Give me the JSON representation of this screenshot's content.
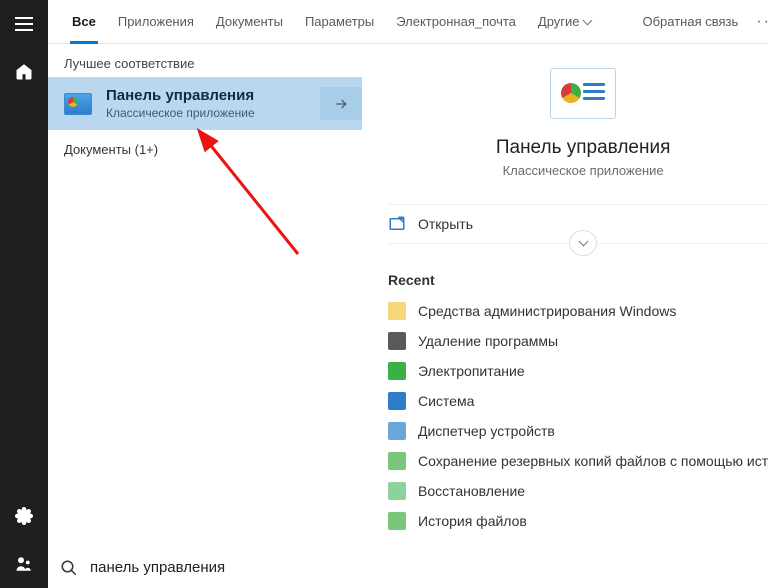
{
  "tabs": {
    "all": "Все",
    "apps": "Приложения",
    "docs": "Документы",
    "settings": "Параметры",
    "email": "Электронная_почта",
    "more": "Другие",
    "feedback": "Обратная связь"
  },
  "results": {
    "best_match_label": "Лучшее соответствие",
    "best": {
      "title": "Панель управления",
      "subtitle": "Классическое приложение"
    },
    "documents_label": "Документы (1+)"
  },
  "preview": {
    "title": "Панель управления",
    "subtitle": "Классическое приложение",
    "open_label": "Открыть",
    "recent_label": "Recent",
    "recent": [
      "Средства администрирования Windows",
      "Удаление программы",
      "Электропитание",
      "Система",
      "Диспетчер устройств",
      "Сохранение резервных копий файлов с помощью ист...",
      "Восстановление",
      "История файлов"
    ]
  },
  "search": {
    "value": "панель управления"
  }
}
